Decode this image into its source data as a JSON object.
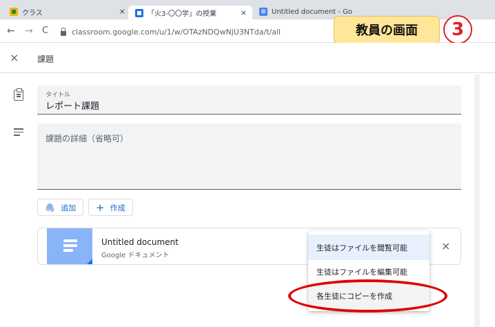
{
  "browser": {
    "tabs": [
      {
        "label": "クラス",
        "close": "×"
      },
      {
        "label": "「火3-〇〇学」の授業",
        "close": "×"
      },
      {
        "label": "Untitled document - Go"
      }
    ],
    "url": "classroom.google.com/u/1/w/OTAzNDQwNjU3NTda/t/all",
    "back": "←",
    "forward": "→",
    "reload": "C"
  },
  "overlay": {
    "label": "教員の画面",
    "number": "3"
  },
  "header": {
    "close": "×",
    "title": "課題"
  },
  "form": {
    "title_label": "タイトル",
    "title_value": "レポート課題",
    "description_placeholder": "課題の詳細（省略可）",
    "add_button": "追加",
    "create_button": "作成"
  },
  "attachment": {
    "title": "Untitled document",
    "subtitle": "Google ドキュメント",
    "remove": "×"
  },
  "menu": {
    "items": [
      {
        "label": "生徒はファイルを閲覧可能",
        "state": "selected"
      },
      {
        "label": "生徒はファイルを編集可能",
        "state": "normal"
      },
      {
        "label": "各生徒にコピーを作成",
        "state": "hover"
      }
    ]
  },
  "colors": {
    "accent": "#1967d2",
    "highlight": "#e00000",
    "overlay_bg": "#ffe699"
  }
}
